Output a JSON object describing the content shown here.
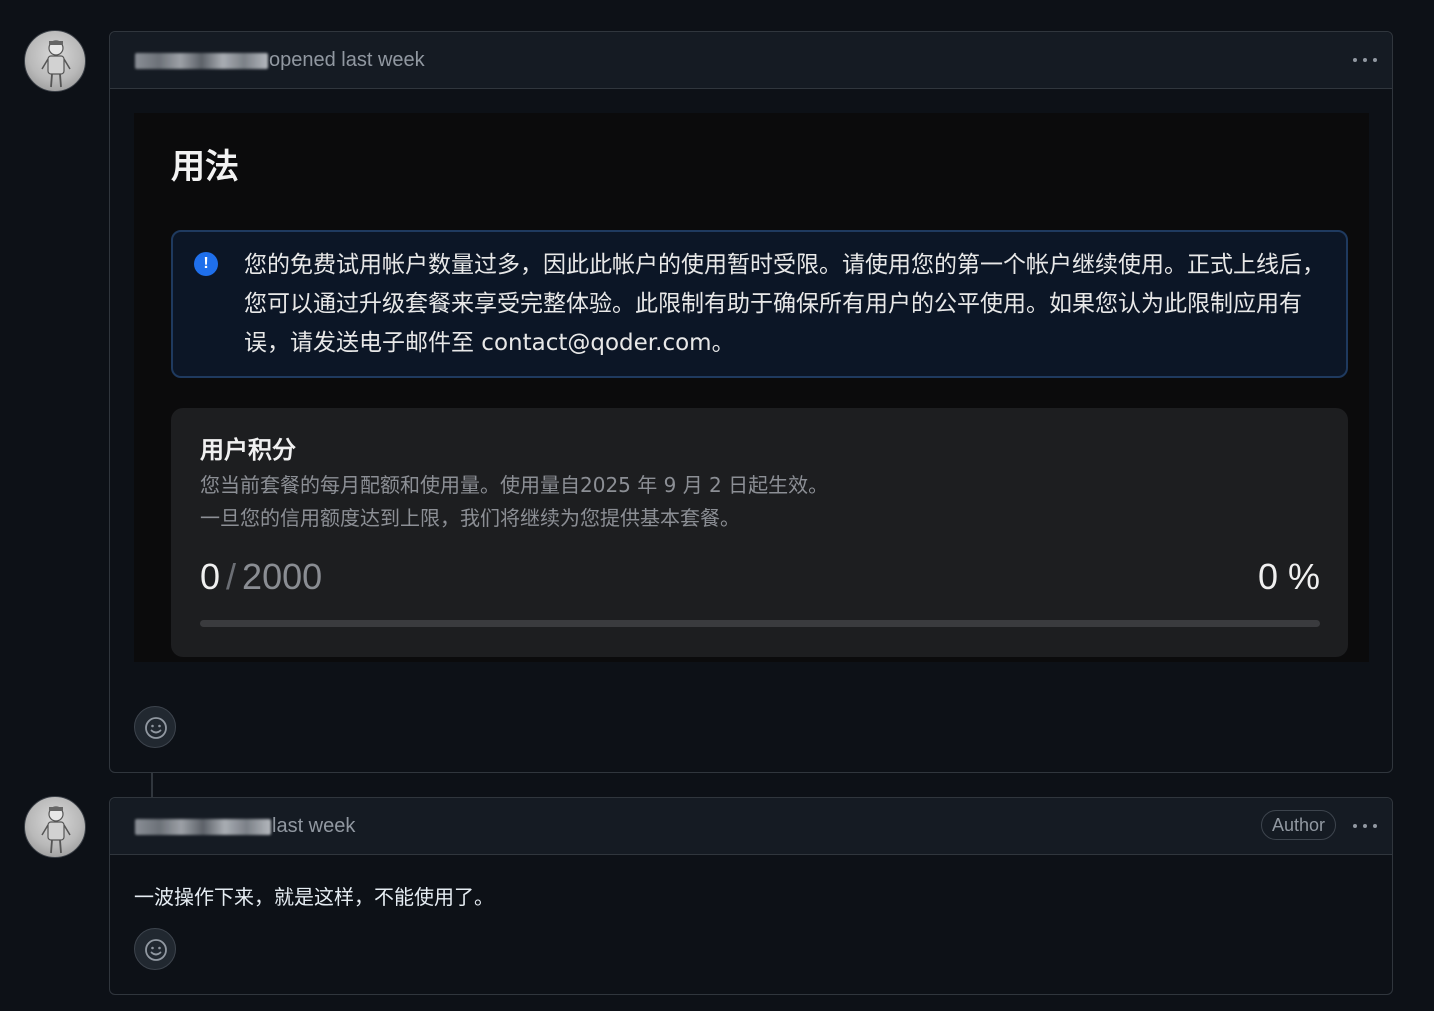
{
  "comments": [
    {
      "author_blurred": true,
      "timestamp": "opened last week",
      "attachment": {
        "title": "用法",
        "alert_icon": "info-icon",
        "alert_text": "您的免费试用帐户数量过多，因此此帐户的使用暂时受限。请使用您的第一个帐户继续使用。正式上线后，您可以通过升级套餐来享受完整体验。此限制有助于确保所有用户的公平使用。如果您认为此限制应用有误，请发送电子邮件至 contact@qoder.com。",
        "credits": {
          "title": "用户积分",
          "desc_line1": "您当前套餐的每月配额和使用量。使用量自2025 年 9 月 2 日起生效。",
          "desc_line2": "一旦您的信用额度达到上限，我们将继续为您提供基本套餐。",
          "used": "0",
          "slash": "/",
          "total": "2000",
          "percent": "0 %",
          "progress_fraction": 0
        }
      },
      "reaction_icon": "smiley-icon"
    },
    {
      "author_blurred": true,
      "timestamp": "last week",
      "badge": "Author",
      "body": "一波操作下来，就是这样，不能使用了。",
      "reaction_icon": "smiley-icon"
    }
  ],
  "icons": {
    "more": "kebab-horizontal-icon"
  },
  "colors": {
    "background": "#0d1117",
    "header": "#151b23",
    "border": "#30363d",
    "alert_blue": "#1f6feb"
  }
}
